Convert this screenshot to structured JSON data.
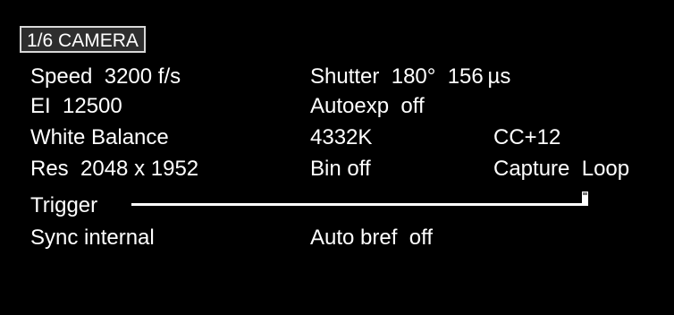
{
  "camera_tab": {
    "label": "1/6 CAMERA"
  },
  "settings": {
    "speed": "Speed  3200 f/s",
    "shutter": "Shutter  180°  156 µs",
    "ei": "EI  12500",
    "autoexp": "Autoexp  off",
    "white_balance": "White Balance",
    "wb_kelvin": "4332K",
    "wb_cc": "CC+12",
    "res": "Res  2048 x 1952",
    "bin": "Bin off",
    "capture_mode": "Capture  Loop",
    "trigger": "Trigger",
    "sync": "Sync internal",
    "auto_bref": "Auto bref  off"
  },
  "colors": {
    "background": "#000000",
    "text": "#ffffff",
    "tab_background": "#2e2e2e",
    "tab_border": "#d8d8d8"
  }
}
